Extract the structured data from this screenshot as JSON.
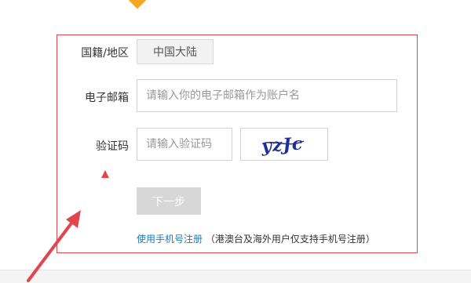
{
  "form": {
    "region_label": "国籍/地区",
    "region_value": "中国大陆",
    "email_label": "电子邮箱",
    "email_placeholder": "请输入你的电子邮箱作为账户名",
    "captcha_label": "验证码",
    "captcha_placeholder": "请输入验证码",
    "captcha_text": "yzJc",
    "next_button": "下一步",
    "phone_register_link": "使用手机号注册",
    "phone_register_note": "（港澳台及海外用户仅支持手机号注册）"
  },
  "colors": {
    "highlight": "#e0474c",
    "link": "#1a7cb5",
    "captcha_ink": "#1e2f9a",
    "marker": "#f5a623",
    "button_disabled": "#d7d7d7"
  },
  "icons": {
    "warning": "red-triangle-icon",
    "annotation": "red-arrow-icon"
  }
}
